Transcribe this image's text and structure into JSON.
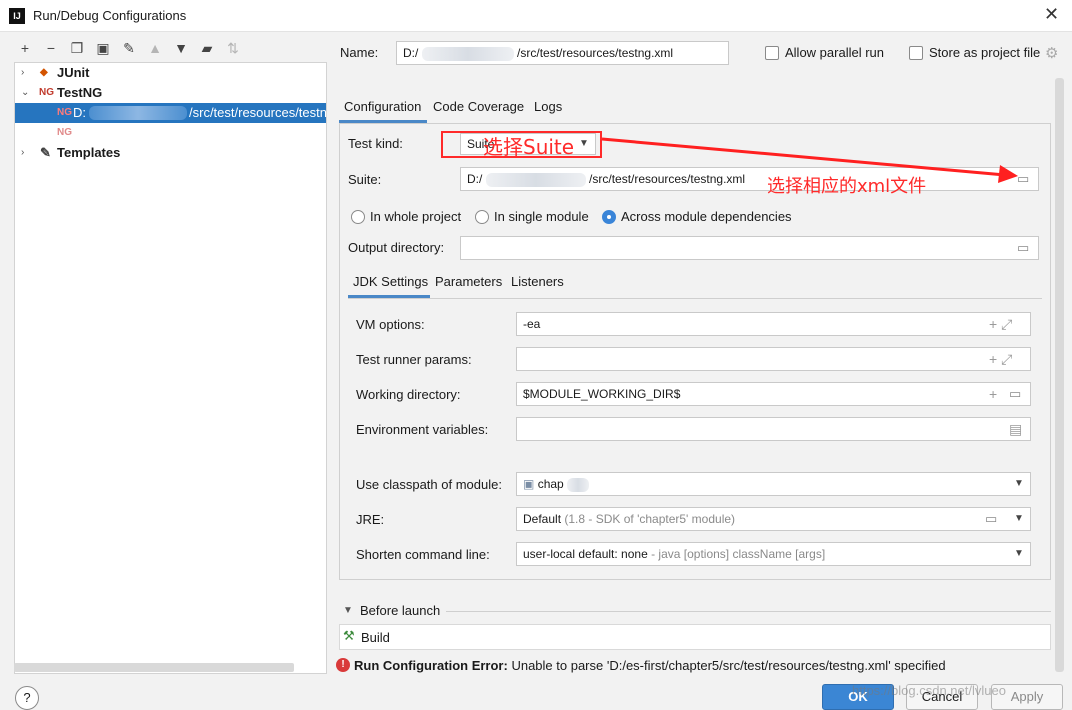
{
  "window": {
    "title": "Run/Debug Configurations",
    "logo": "IJ"
  },
  "toolbar": {
    "icons": [
      "add-icon",
      "remove-icon",
      "copy-icon",
      "save-icon",
      "wrench-icon",
      "move-up-icon",
      "move-down-icon",
      "folder-add-icon",
      "sort-icon"
    ]
  },
  "tree": {
    "junit": "JUnit",
    "testng": "TestNG",
    "selected_prefix": "D:",
    "selected_suffix": "/src/test/resources/testn",
    "templates": "Templates"
  },
  "name_field": {
    "label": "Name:",
    "prefix": "D:/",
    "suffix": "/src/test/resources/testng.xml"
  },
  "checkboxes": {
    "parallel": "Allow parallel run",
    "store": "Store as project file"
  },
  "tabs": {
    "configuration": "Configuration",
    "code_coverage": "Code Coverage",
    "logs": "Logs"
  },
  "config": {
    "test_kind_label": "Test kind:",
    "test_kind_value": "Suite",
    "suite_label": "Suite:",
    "suite_prefix": "D:/",
    "suite_suffix": "/src/test/resources/testng.xml",
    "scope_whole": "In whole project",
    "scope_single": "In single module",
    "scope_across": "Across module dependencies",
    "output_label": "Output directory:",
    "output_value": ""
  },
  "annotations": {
    "box_text": "选择Suite",
    "arrow_text": "选择相应的xml文件"
  },
  "subtabs": {
    "jdk": "JDK Settings",
    "params": "Parameters",
    "listeners": "Listeners"
  },
  "jdk": {
    "vm_label": "VM options:",
    "vm_value": "-ea",
    "runner_label": "Test runner params:",
    "runner_value": "",
    "workdir_label": "Working directory:",
    "workdir_value": "$MODULE_WORKING_DIR$",
    "env_label": "Environment variables:",
    "env_value": "",
    "classpath_label": "Use classpath of module:",
    "classpath_value": "chap",
    "jre_label": "JRE:",
    "jre_value": "Default",
    "jre_detail": "(1.8 - SDK of 'chapter5' module)",
    "shorten_label": "Shorten command line:",
    "shorten_value": "user-local default: none",
    "shorten_detail": "- java [options] className [args]"
  },
  "before_launch": {
    "label": "Before launch",
    "build": "Build"
  },
  "error": {
    "title": "Run Configuration Error:",
    "message": "Unable to parse 'D:/es-first/chapter5/src/test/resources/testng.xml' specified"
  },
  "buttons": {
    "ok": "OK",
    "cancel": "Cancel",
    "apply": "Apply",
    "help": "?"
  },
  "watermark": "https://blog.csdn.net/lvlueo"
}
